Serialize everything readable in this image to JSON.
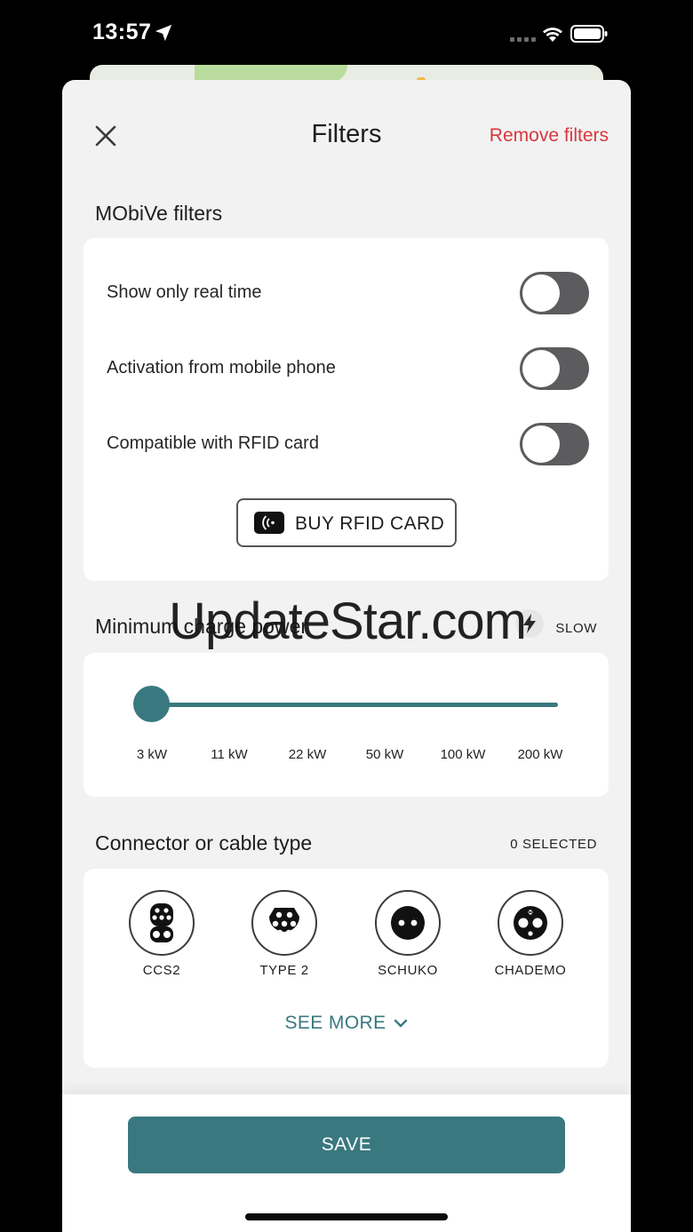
{
  "status_bar": {
    "time": "13:57"
  },
  "header": {
    "title": "Filters",
    "remove_label": "Remove filters"
  },
  "mobive": {
    "title": "MObiVe filters",
    "toggles": [
      {
        "label": "Show only real time",
        "on": false
      },
      {
        "label": "Activation from mobile phone",
        "on": false
      },
      {
        "label": "Compatible with RFID card",
        "on": false
      }
    ],
    "rfid_button": "BUY RFID CARD"
  },
  "power": {
    "title": "Minimum charge power",
    "speed_label": "SLOW",
    "ticks": [
      "3 kW",
      "11 kW",
      "22 kW",
      "50 kW",
      "100 kW",
      "200 kW"
    ],
    "selected": "3 kW"
  },
  "connectors": {
    "title": "Connector or cable type",
    "selected_label": "0 SELECTED",
    "items": [
      {
        "label": "CCS2",
        "icon": "ccs2-connector-icon"
      },
      {
        "label": "TYPE 2",
        "icon": "type2-connector-icon"
      },
      {
        "label": "SCHUKO",
        "icon": "schuko-connector-icon"
      },
      {
        "label": "CHADEMO",
        "icon": "chademo-connector-icon"
      }
    ],
    "see_more": "SEE MORE"
  },
  "footer": {
    "save_label": "SAVE"
  },
  "watermark": "UpdateStar.com",
  "colors": {
    "accent": "#3a7880",
    "danger": "#d9373e",
    "toggle_off": "#5c5c5e"
  }
}
